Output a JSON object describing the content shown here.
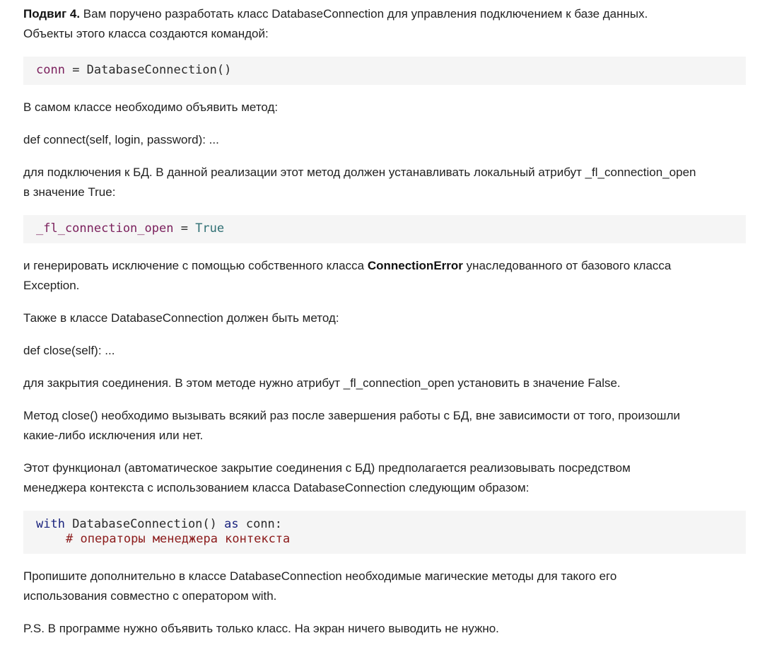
{
  "intro": {
    "title": "Подвиг 4.",
    "line1": " Вам поручено разработать класс DatabaseConnection для управления подключением к базе данных.",
    "line2": "Объекты этого класса создаются командой:"
  },
  "code1": {
    "var": "conn",
    "rest": " = DatabaseConnection()"
  },
  "p_declare": "В самом классе необходимо объявить метод:",
  "p_connect_def": "def connect(self, login, password): ...",
  "p_connect_desc": {
    "line1": "для подключения к БД. В данной реализации этот метод должен устанавливать локальный атрибут _fl_connection_open",
    "line2": "в значение True:"
  },
  "code2": {
    "var": "_fl_connection_open",
    "op": " = ",
    "value": "True"
  },
  "p_exception": {
    "line1_before": "и генерировать исключение с помощью собственного класса ",
    "class_name": "ConnectionError",
    "line1_after": " унаследованного от базового класса",
    "line2": "Exception."
  },
  "p_also": "Также в классе DatabaseConnection должен быть метод:",
  "p_close_def": "def close(self): ...",
  "p_close_desc": "для закрытия соединения. В этом методе нужно атрибут _fl_connection_open установить в значение False.",
  "p_close_always": {
    "line1": "Метод close() необходимо вызывать всякий раз после завершения работы с БД, вне зависимости от того, произошли",
    "line2": "какие-либо исключения или нет."
  },
  "p_context": {
    "line1": "Этот функционал (автоматическое закрытие соединения с БД) предполагается реализовывать посредством",
    "line2": "менеджера контекста с использованием класса DatabaseConnection следующим образом:"
  },
  "code3": {
    "kw_with": "with",
    "mid": " DatabaseConnection() ",
    "kw_as": "as",
    "end": " conn:",
    "comment": "# операторы менеджера контекста"
  },
  "p_magic": {
    "line1": "Пропишите дополнительно в классе DatabaseConnection необходимые магические методы для такого его",
    "line2": "использования совместно с оператором with."
  },
  "p_ps": "P.S. В программе нужно объявить только класс. На экран ничего выводить не нужно."
}
